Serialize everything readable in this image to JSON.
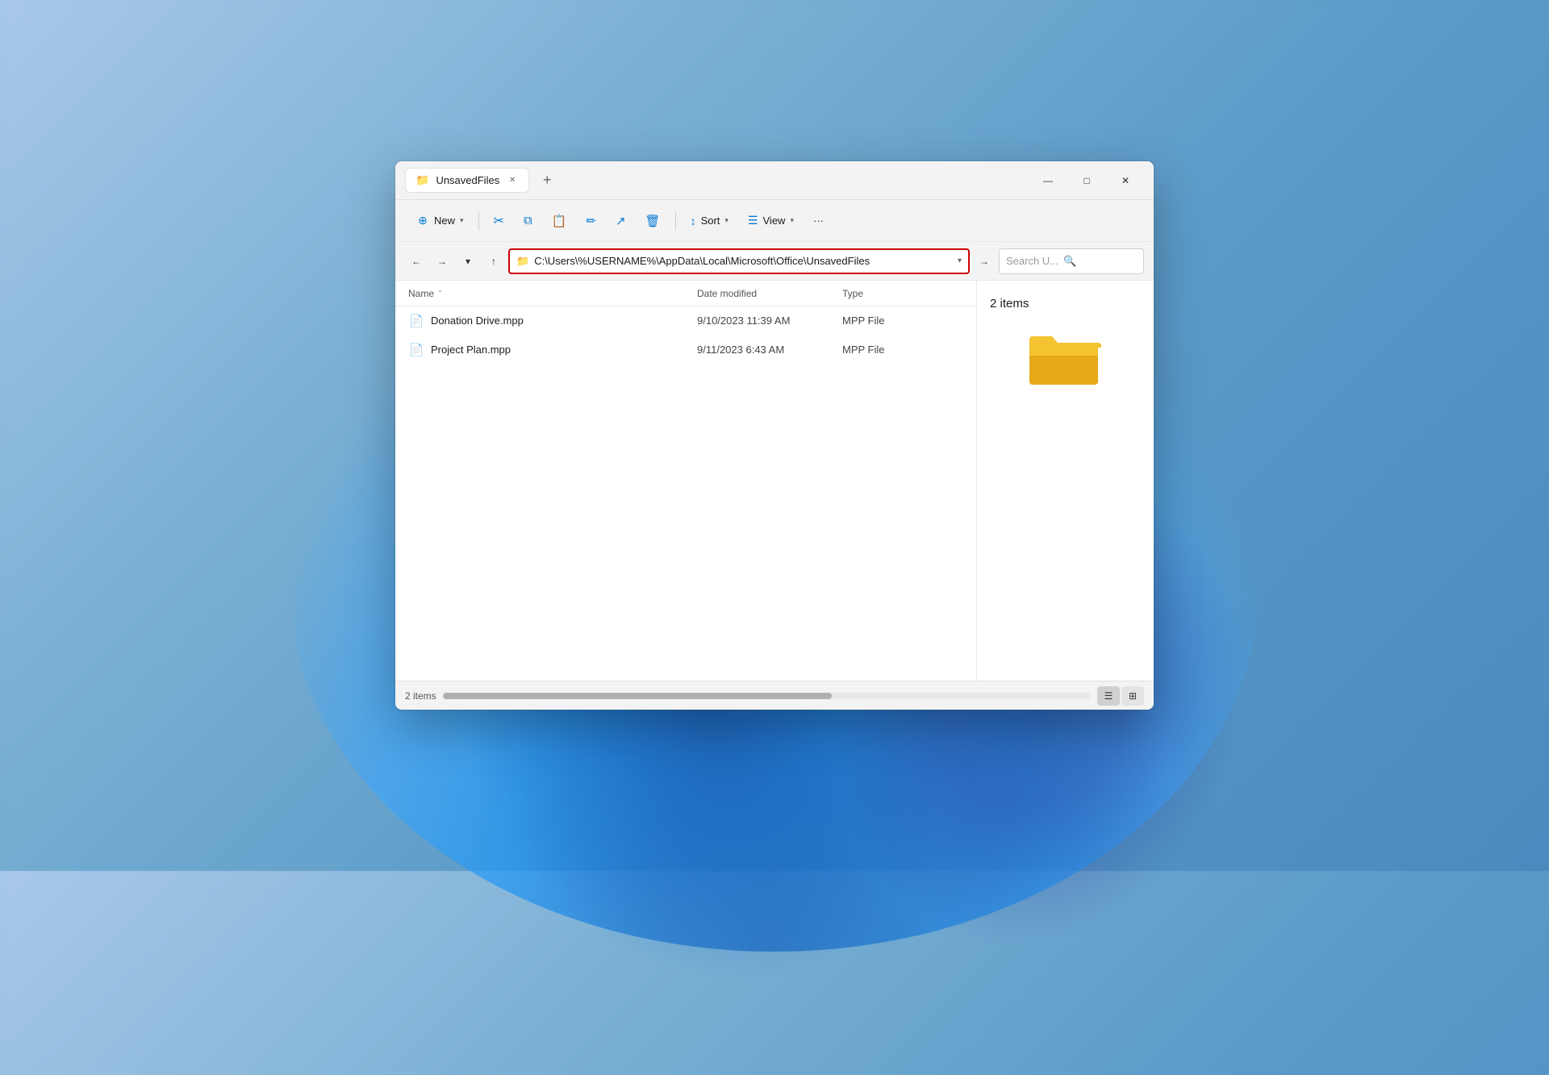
{
  "window": {
    "title": "UnsavedFiles",
    "tab_label": "UnsavedFiles"
  },
  "title_bar": {
    "close_label": "✕",
    "minimize_label": "—",
    "maximize_label": "□",
    "new_tab_label": "+"
  },
  "toolbar": {
    "new_label": "New",
    "new_dropdown": "▾",
    "sort_label": "Sort",
    "sort_dropdown": "▾",
    "view_label": "View",
    "view_dropdown": "▾",
    "more_label": "···",
    "cut_icon": "✂",
    "copy_icon": "⧉",
    "paste_icon": "⬜",
    "rename_icon": "✏",
    "share_icon": "↗",
    "delete_icon": "🗑"
  },
  "nav": {
    "back_icon": "←",
    "forward_icon": "→",
    "dropdown_icon": "▾",
    "up_icon": "↑",
    "address": "C:\\Users\\%USERNAME%\\AppData\\Local\\Microsoft\\Office\\UnsavedFiles",
    "address_dropdown": "▾",
    "go_icon": "→",
    "search_placeholder": "Search U...",
    "search_icon": "🔍"
  },
  "file_list": {
    "headers": {
      "name": "Name",
      "sort_arrow": "⌃",
      "date_modified": "Date modified",
      "type": "Type"
    },
    "files": [
      {
        "name": "Donation Drive.mpp",
        "date_modified": "9/10/2023 11:39 AM",
        "type": "MPP File"
      },
      {
        "name": "Project Plan.mpp",
        "date_modified": "9/11/2023 6:43 AM",
        "type": "MPP File"
      }
    ]
  },
  "preview": {
    "item_count": "2 items"
  },
  "status_bar": {
    "count": "2 items"
  },
  "colors": {
    "accent": "#0078d4",
    "address_border": "#cc0000",
    "folder_yellow": "#f4c430",
    "folder_dark": "#e6a817"
  }
}
